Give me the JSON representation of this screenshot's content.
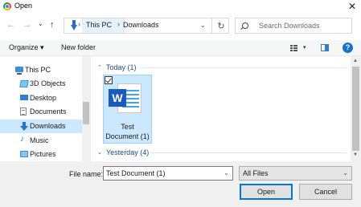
{
  "window": {
    "title": "Open",
    "close_glyph": "✕"
  },
  "nav_buttons": {
    "back": "←",
    "forward": "→",
    "recent": "⌄",
    "up": "↑"
  },
  "address": {
    "segments": [
      "This PC",
      "Downloads"
    ],
    "separator": "›",
    "dropdown": "⌄",
    "refresh": "↻"
  },
  "search": {
    "placeholder": "Search Downloads"
  },
  "toolbar": {
    "organize": "Organize ▾",
    "new_folder": "New folder",
    "view_dropdown": "▾",
    "help": "?"
  },
  "sidebar": {
    "items": [
      {
        "label": "This PC",
        "icon": "computer-icon"
      },
      {
        "label": "3D Objects",
        "icon": "3d-objects-icon"
      },
      {
        "label": "Desktop",
        "icon": "desktop-icon"
      },
      {
        "label": "Documents",
        "icon": "documents-icon"
      },
      {
        "label": "Downloads",
        "icon": "downloads-icon",
        "selected": true
      },
      {
        "label": "Music",
        "icon": "music-icon"
      },
      {
        "label": "Pictures",
        "icon": "pictures-icon"
      }
    ]
  },
  "groups": [
    {
      "label": "Today (1)",
      "chevron": "⌃"
    },
    {
      "label": "Yesterday (4)",
      "chevron": "⌄"
    }
  ],
  "files": [
    {
      "name_line1": "Test",
      "name_line2": "Document (1)",
      "icon": "word-document-icon",
      "badge": "W",
      "selected": true
    }
  ],
  "scrollbar": {
    "up": "▲",
    "down": "▼"
  },
  "footer": {
    "file_name_label": "File name:",
    "file_name_value": "Test Document (1)",
    "file_name_dropdown": "⌄",
    "file_type": "All Files",
    "file_type_dropdown": "⌄",
    "open": "Open",
    "cancel": "Cancel"
  },
  "colors": {
    "selection": "#cce8ff",
    "accent": "#0078d7",
    "word_blue": "#185abd",
    "group_header": "#1e4d8c"
  }
}
